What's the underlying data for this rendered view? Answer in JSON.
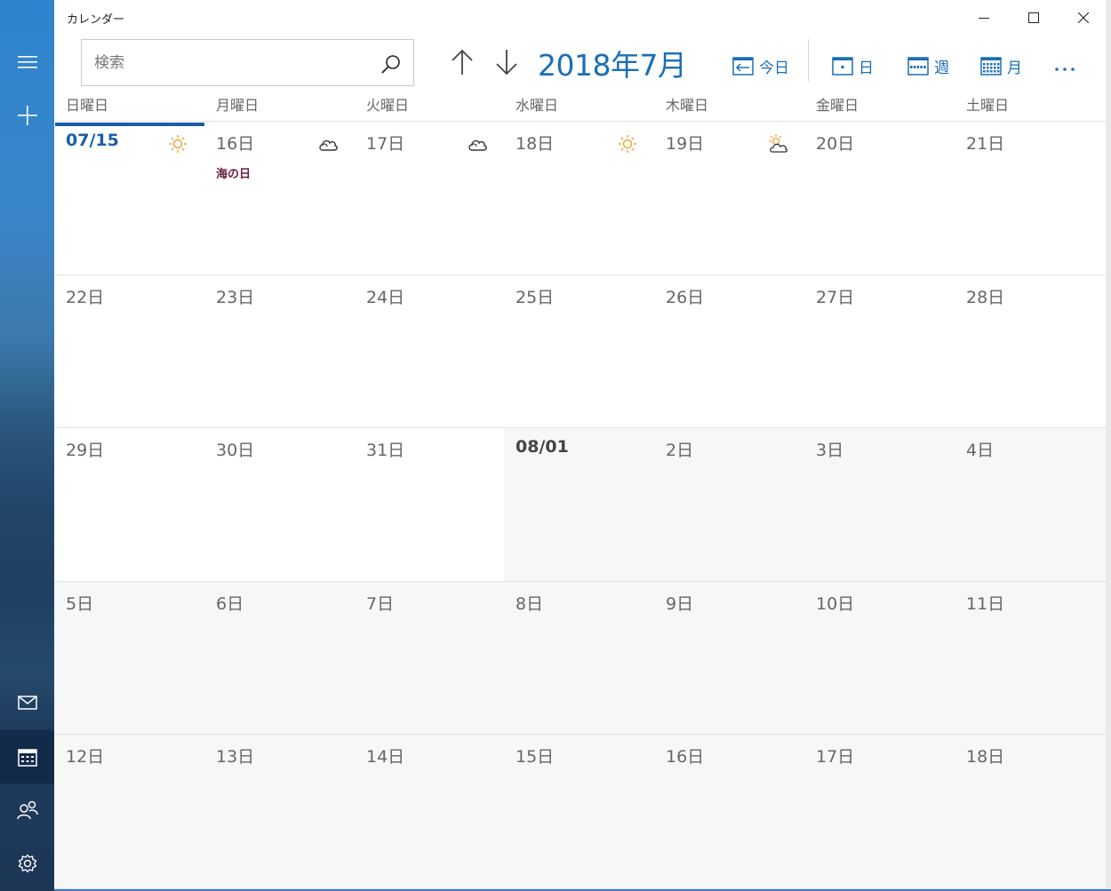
{
  "app": {
    "title": "カレンダー"
  },
  "rail": {
    "menu_icon": "hamburger-icon",
    "new_event_icon": "plus-icon",
    "mail_icon": "mail-icon",
    "calendar_icon": "calendar-icon",
    "people_icon": "people-icon",
    "settings_icon": "gear-icon"
  },
  "search": {
    "placeholder": "検索"
  },
  "header": {
    "month_title": "2018年7月"
  },
  "toolbar": {
    "today_label": "今日",
    "day_label": "日",
    "week_label": "週",
    "month_label": "月"
  },
  "weekdays": [
    "日曜日",
    "月曜日",
    "火曜日",
    "水曜日",
    "木曜日",
    "金曜日",
    "土曜日"
  ],
  "weeks": [
    [
      {
        "label": "07/15",
        "kind": "today",
        "weather": "sun"
      },
      {
        "label": "16日",
        "kind": "current",
        "weather": "cloud",
        "holiday": "海の日"
      },
      {
        "label": "17日",
        "kind": "current",
        "weather": "cloud"
      },
      {
        "label": "18日",
        "kind": "current",
        "weather": "sun"
      },
      {
        "label": "19日",
        "kind": "current",
        "weather": "partly-cloudy"
      },
      {
        "label": "20日",
        "kind": "current"
      },
      {
        "label": "21日",
        "kind": "current"
      }
    ],
    [
      {
        "label": "22日",
        "kind": "current"
      },
      {
        "label": "23日",
        "kind": "current"
      },
      {
        "label": "24日",
        "kind": "current"
      },
      {
        "label": "25日",
        "kind": "current"
      },
      {
        "label": "26日",
        "kind": "current"
      },
      {
        "label": "27日",
        "kind": "current"
      },
      {
        "label": "28日",
        "kind": "current"
      }
    ],
    [
      {
        "label": "29日",
        "kind": "current"
      },
      {
        "label": "30日",
        "kind": "current"
      },
      {
        "label": "31日",
        "kind": "current"
      },
      {
        "label": "08/01",
        "kind": "first"
      },
      {
        "label": "2日",
        "kind": "other"
      },
      {
        "label": "3日",
        "kind": "other"
      },
      {
        "label": "4日",
        "kind": "other"
      }
    ],
    [
      {
        "label": "5日",
        "kind": "other"
      },
      {
        "label": "6日",
        "kind": "other"
      },
      {
        "label": "7日",
        "kind": "other"
      },
      {
        "label": "8日",
        "kind": "other"
      },
      {
        "label": "9日",
        "kind": "other"
      },
      {
        "label": "10日",
        "kind": "other"
      },
      {
        "label": "11日",
        "kind": "other"
      }
    ],
    [
      {
        "label": "12日",
        "kind": "other"
      },
      {
        "label": "13日",
        "kind": "other"
      },
      {
        "label": "14日",
        "kind": "other"
      },
      {
        "label": "15日",
        "kind": "other"
      },
      {
        "label": "16日",
        "kind": "other"
      },
      {
        "label": "17日",
        "kind": "other"
      },
      {
        "label": "18日",
        "kind": "other"
      }
    ]
  ],
  "colors": {
    "accent": "#1a6fb5",
    "today": "#1a5fa6",
    "holiday": "#6b1d3f",
    "sun": "#f0a030",
    "other_month_bg": "#f7f7f7"
  }
}
